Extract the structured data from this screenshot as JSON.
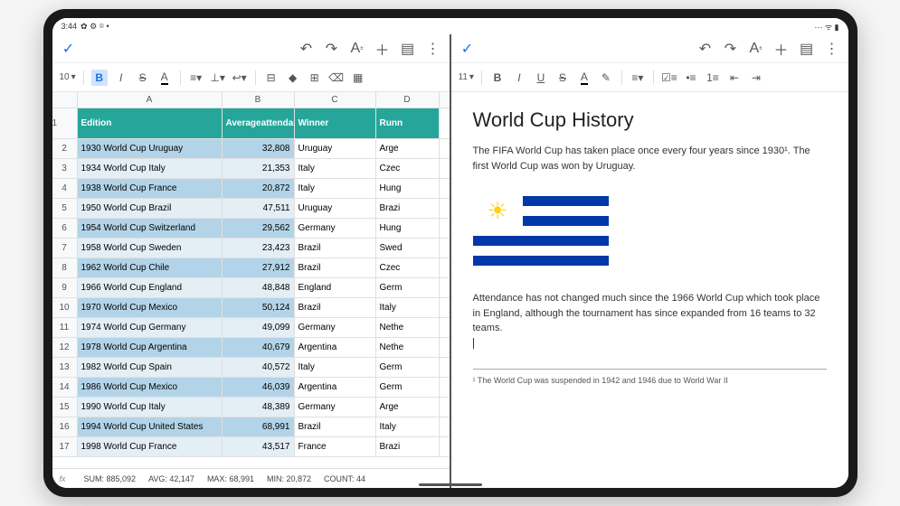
{
  "statusbar": {
    "time": "3:44",
    "icons_left": "✿ ⚙ ⌾ •",
    "icons_right": "⋯ ᯤ ▮"
  },
  "sheets": {
    "fontsize": "10",
    "colHeaders": [
      "A",
      "B",
      "C",
      "D"
    ],
    "header": {
      "A": "Edition",
      "B1": "Average",
      "B2": "attendance",
      "C": "Winner",
      "D": "Runn"
    },
    "rows": [
      {
        "n": "2",
        "a": "1930 World Cup Uruguay",
        "b": "32,808",
        "c": "Uruguay",
        "d": "Arge",
        "sel": true
      },
      {
        "n": "3",
        "a": "1934 World Cup Italy",
        "b": "21,353",
        "c": "Italy",
        "d": "Czec",
        "sel": true,
        "even": true
      },
      {
        "n": "4",
        "a": "1938 World Cup France",
        "b": "20,872",
        "c": "Italy",
        "d": "Hung",
        "sel": true
      },
      {
        "n": "5",
        "a": "1950 World Cup Brazil",
        "b": "47,511",
        "c": "Uruguay",
        "d": "Brazi",
        "sel": true,
        "even": true
      },
      {
        "n": "6",
        "a": "1954 World Cup Switzerland",
        "b": "29,562",
        "c": "Germany",
        "d": "Hung",
        "sel": true
      },
      {
        "n": "7",
        "a": "1958 World Cup Sweden",
        "b": "23,423",
        "c": "Brazil",
        "d": "Swed",
        "sel": true,
        "even": true
      },
      {
        "n": "8",
        "a": "1962 World Cup Chile",
        "b": "27,912",
        "c": "Brazil",
        "d": "Czec",
        "sel": true
      },
      {
        "n": "9",
        "a": "1966 World Cup England",
        "b": "48,848",
        "c": "England",
        "d": "Germ",
        "sel": true,
        "even": true
      },
      {
        "n": "10",
        "a": "1970 World Cup Mexico",
        "b": "50,124",
        "c": "Brazil",
        "d": "Italy",
        "sel": true
      },
      {
        "n": "11",
        "a": "1974 World Cup Germany",
        "b": "49,099",
        "c": "Germany",
        "d": "Nethe",
        "sel": true,
        "even": true
      },
      {
        "n": "12",
        "a": "1978 World Cup Argentina",
        "b": "40,679",
        "c": "Argentina",
        "d": "Nethe",
        "sel": true
      },
      {
        "n": "13",
        "a": "1982 World Cup Spain",
        "b": "40,572",
        "c": "Italy",
        "d": "Germ",
        "sel": true,
        "even": true
      },
      {
        "n": "14",
        "a": "1986 World Cup Mexico",
        "b": "46,039",
        "c": "Argentina",
        "d": "Germ",
        "sel": true
      },
      {
        "n": "15",
        "a": "1990 World Cup Italy",
        "b": "48,389",
        "c": "Germany",
        "d": "Arge",
        "sel": true,
        "even": true
      },
      {
        "n": "16",
        "a": "1994 World Cup United States",
        "b": "68,991",
        "c": "Brazil",
        "d": "Italy",
        "sel": true
      },
      {
        "n": "17",
        "a": "1998 World Cup France",
        "b": "43,517",
        "c": "France",
        "d": "Brazi",
        "sel": true,
        "even": true
      }
    ],
    "stats": {
      "sum": "SUM: 885,092",
      "avg": "AVG: 42,147",
      "max": "MAX: 68,991",
      "min": "MIN: 20,872",
      "count": "COUNT: 44"
    }
  },
  "docs": {
    "fontsize": "11",
    "title": "World Cup History",
    "p1": "The FIFA World Cup has taken place once every four years since 1930¹. The first World Cup was won by Uruguay.",
    "p2": "Attendance has not changed much since the 1966 World Cup which took place in England, although the tournament has since expanded from 16 teams to 32 teams.",
    "footnote": "¹ The World Cup was suspended in 1942 and 1946 due to World War II"
  }
}
